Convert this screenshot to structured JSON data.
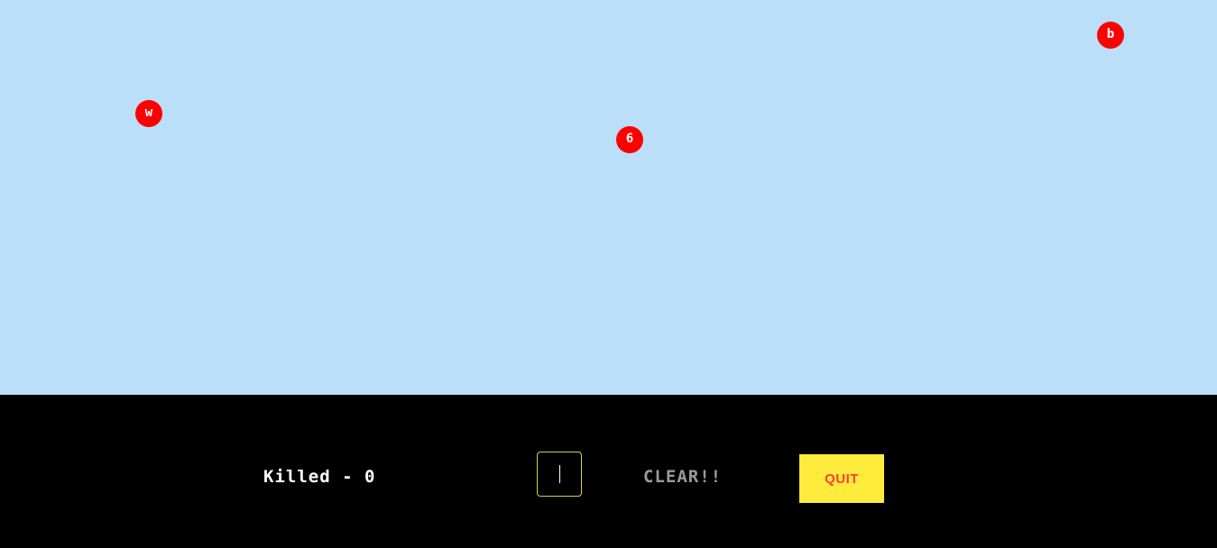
{
  "enemies": [
    {
      "letter": "w"
    },
    {
      "letter": "6"
    },
    {
      "letter": "b"
    }
  ],
  "hud": {
    "killed_text": "Killed - 0",
    "input_value": "",
    "clear_label": "CLEAR!!",
    "quit_label": "QUIT"
  },
  "colors": {
    "sky": "#bbdff9",
    "enemy": "#ff0000",
    "hud_background": "#000000",
    "quit_button": "#ffeb3b",
    "quit_text": "#f44336",
    "input_border": "#d8cf3c"
  }
}
